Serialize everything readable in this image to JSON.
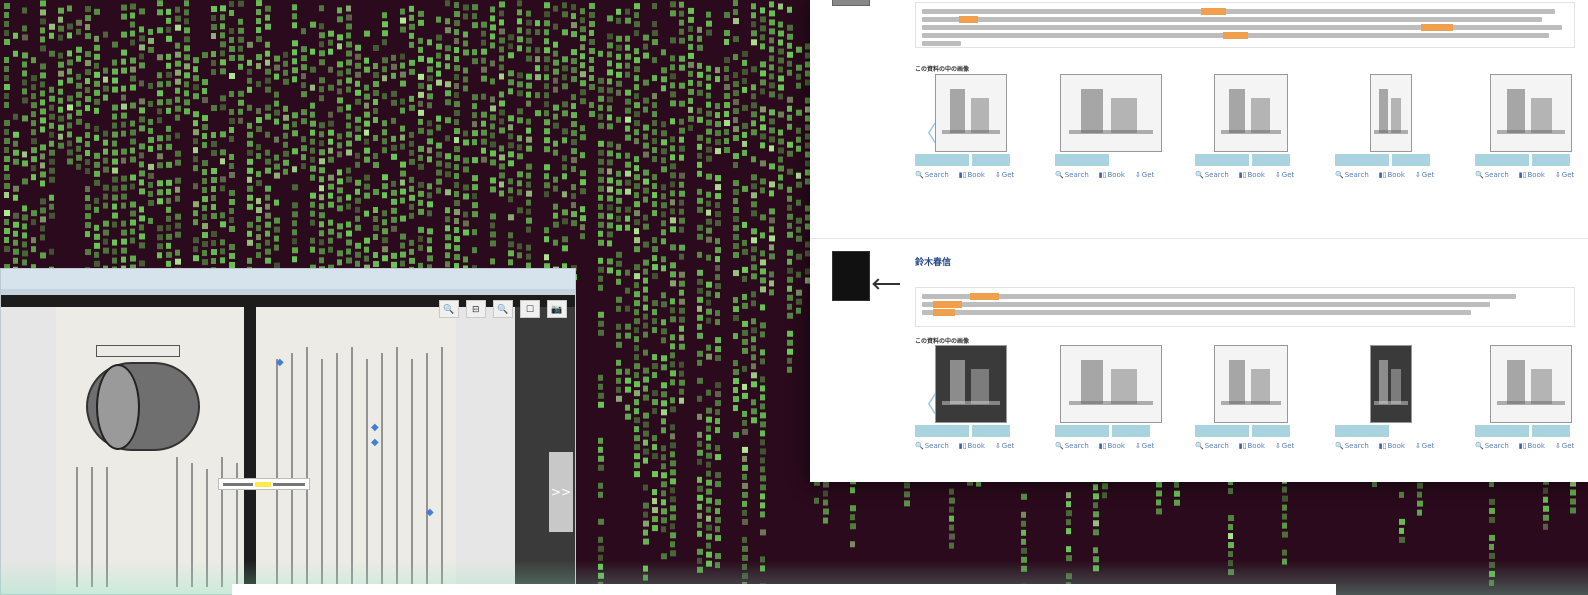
{
  "background": {
    "theme": "matrix-code-rain",
    "colors": {
      "base": "#2a0a1c",
      "glyph": "#6fd65a",
      "glyph_bright": "#b8f59a"
    }
  },
  "search_window": {
    "results": [
      {
        "title": "",
        "meta": "",
        "section_label": "この資料の中の画像",
        "images": [
          {
            "tags": 2,
            "actions": [
              "Search",
              "Book",
              "Get"
            ]
          },
          {
            "tags": 1,
            "actions": [
              "Search",
              "Book",
              "Get"
            ]
          },
          {
            "tags": 2,
            "actions": [
              "Search",
              "Book",
              "Get"
            ]
          },
          {
            "tags": 2,
            "actions": [
              "Search",
              "Book",
              "Get"
            ]
          },
          {
            "tags": 2,
            "actions": [
              "Search",
              "Book",
              "Get"
            ]
          }
        ]
      },
      {
        "title": "鈴木春信",
        "meta": "",
        "section_label": "この資料の中の画像",
        "images": [
          {
            "tags": 2,
            "actions": [
              "Search",
              "Book",
              "Get"
            ]
          },
          {
            "tags": 2,
            "actions": [
              "Search",
              "Book",
              "Get"
            ]
          },
          {
            "tags": 2,
            "actions": [
              "Search",
              "Book",
              "Get"
            ]
          },
          {
            "tags": 1,
            "actions": [
              "Search",
              "Book",
              "Get"
            ]
          },
          {
            "tags": 2,
            "actions": [
              "Search",
              "Book",
              "Get"
            ]
          }
        ]
      }
    ],
    "highlight_color": "#f0a04c",
    "tag_color": "#a8d3df",
    "link_color": "#5a7ec0"
  },
  "book_viewer": {
    "toolbar_icons": [
      "zoom-in-icon",
      "fit-page-icon",
      "zoom-out-icon",
      "single-page-icon",
      "camera-icon"
    ],
    "toolbar_glyphs": [
      "🔍",
      "⊟",
      "🔍",
      "☐",
      "📷"
    ],
    "next_label": ">>"
  },
  "icons": {
    "search": "🔍",
    "book": "▮▯",
    "get": "⇩",
    "prev": "〈"
  }
}
